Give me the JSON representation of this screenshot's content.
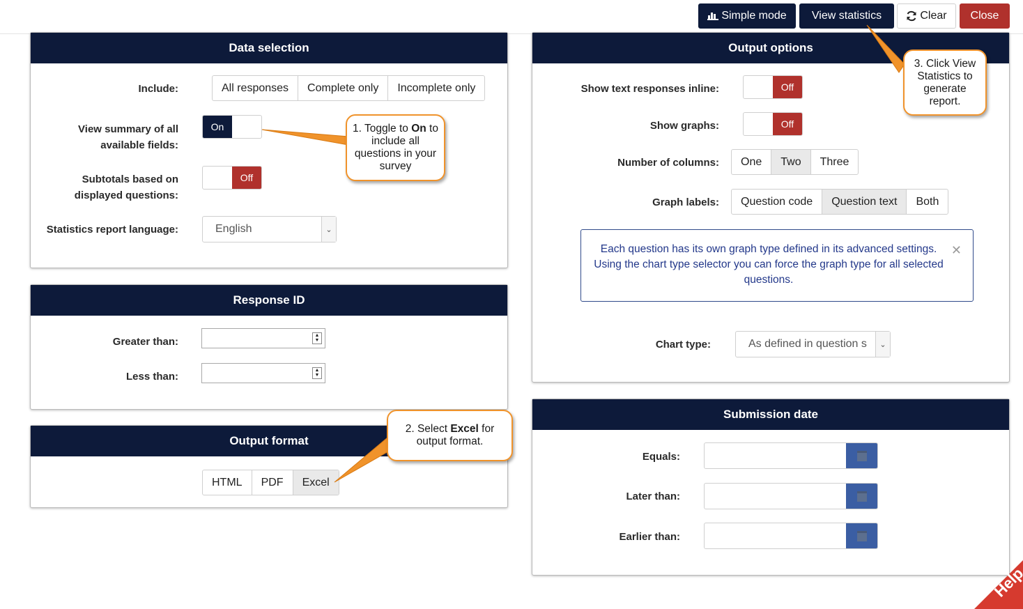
{
  "toolbar": {
    "simple_mode": "Simple mode",
    "view_statistics": "View statistics",
    "clear": "Clear",
    "close": "Close"
  },
  "data_selection": {
    "title": "Data selection",
    "include_label": "Include:",
    "include_options": [
      "All responses",
      "Complete only",
      "Incomplete only"
    ],
    "view_summary_label": "View summary of all available fields:",
    "view_summary_state": "On",
    "subtotals_label": "Subtotals based on displayed questions:",
    "subtotals_state": "Off",
    "language_label": "Statistics report language:",
    "language_value": "English"
  },
  "response_id": {
    "title": "Response ID",
    "greater_label": "Greater than:",
    "greater_value": "",
    "less_label": "Less than:",
    "less_value": ""
  },
  "output_format": {
    "title": "Output format",
    "options": [
      "HTML",
      "PDF",
      "Excel"
    ],
    "selected": "Excel"
  },
  "output_options": {
    "title": "Output options",
    "text_inline_label": "Show text responses inline:",
    "text_inline_state": "Off",
    "graphs_label": "Show graphs:",
    "graphs_state": "Off",
    "columns_label": "Number of columns:",
    "columns_options": [
      "One",
      "Two",
      "Three"
    ],
    "columns_selected": "Two",
    "graph_labels_label": "Graph labels:",
    "graph_labels_options": [
      "Question code",
      "Question text",
      "Both"
    ],
    "graph_labels_selected": "Question text",
    "info_text": "Each question has its own graph type defined in its advanced settings. Using the chart type selector you can force the graph type for all selected questions.",
    "chart_type_label": "Chart type:",
    "chart_type_value": "As defined in question s"
  },
  "submission_date": {
    "title": "Submission date",
    "equals_label": "Equals:",
    "later_label": "Later than:",
    "earlier_label": "Earlier than:"
  },
  "callouts": {
    "c1_pre": "1. Toggle to ",
    "c1_bold": "On",
    "c1_post": " to include all questions in your survey",
    "c2_pre": "2. Select ",
    "c2_bold": "Excel",
    "c2_post": " for output format.",
    "c3": "3. Click View Statistics to generate report."
  },
  "help_tab": "Help",
  "colors": {
    "navy": "#0d1a3a",
    "red": "#b0312c",
    "orange": "#f0932b",
    "calendar_blue": "#3b5ea3"
  }
}
